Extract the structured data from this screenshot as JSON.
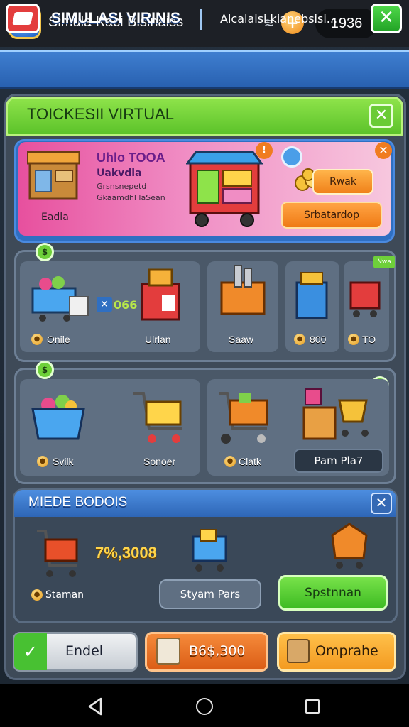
{
  "topbar": {
    "title": "Simula Kaci Bisinaiss",
    "coins": "1936",
    "coin_symbol": "+"
  },
  "header": {
    "title": "SIMULASI VIRINIS",
    "subtitle": "Alcalaisi kianebsisi...",
    "close": "✕"
  },
  "panel": {
    "title": "TOICKESII VIRTUAL",
    "close": "✕"
  },
  "featured": {
    "title": "Uhlo TOOA",
    "subtitle": "Uakvdla",
    "desc1": "Grsnsnepetd",
    "desc2": "Gkaamdhl laSean",
    "stall_label": "Eadla",
    "badge": "!",
    "close": "✕",
    "buy_label": "Rwak",
    "action_label": "Srbatardop"
  },
  "row1": {
    "badge": "$",
    "count": "066",
    "tiles": [
      {
        "label": "Onile",
        "icon": "basket-icon"
      },
      {
        "label": "Ulrlan",
        "icon": "red-box-icon"
      },
      {
        "label": "Saaw",
        "icon": "orange-stall-icon"
      },
      {
        "label": "800",
        "icon": "blue-bin-icon"
      },
      {
        "label": "TO",
        "icon": "red-cart-icon"
      }
    ],
    "corner_tag": "Nwa"
  },
  "row2": {
    "badge": "$",
    "check": "✓",
    "tiles": [
      {
        "label": "Svilk",
        "icon": "blue-basket-icon"
      },
      {
        "label": "Sonoer",
        "icon": "yellow-cart-icon"
      },
      {
        "label": "Clatk",
        "icon": "orange-cart-icon"
      }
    ],
    "button_label": "Pam Pla7"
  },
  "deals": {
    "title": "MIEDE BODOIS",
    "close": "✕",
    "value": "7%,3008",
    "label": "Staman",
    "mid_button": "Styam Pars",
    "green_button": "Spstnnan"
  },
  "bottom": {
    "left_label": "Endel",
    "left_icon": "✓",
    "mid_label": "B6$,300",
    "right_label": "Omprahe"
  }
}
